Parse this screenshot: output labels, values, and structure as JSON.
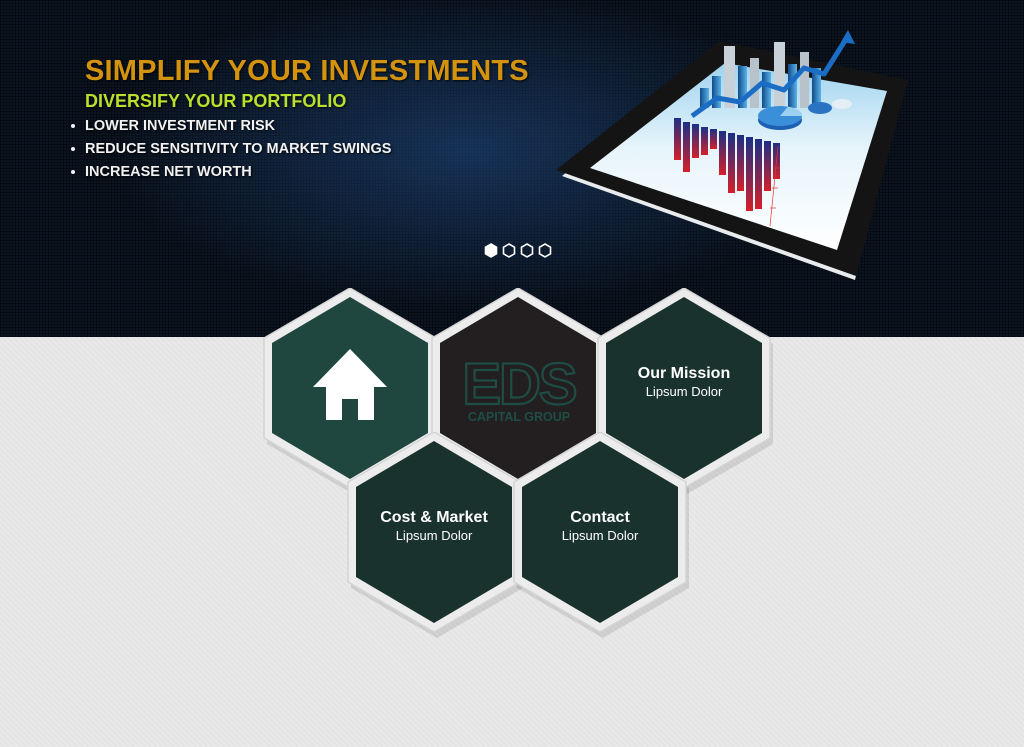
{
  "hero": {
    "headline": "SIMPLIFY YOUR INVESTMENTS",
    "subheadline": "DIVERSIFY YOUR PORTFOLIO",
    "bullets": [
      "LOWER INVESTMENT RISK",
      "REDUCE SENSITIVITY TO MARKET SWINGS",
      "INCREASE NET WORTH"
    ],
    "slider": {
      "total_slides": 4,
      "active_slide": 1
    }
  },
  "logo": {
    "mark": "EDS",
    "tagline": "CAPITAL GROUP"
  },
  "tiles": [
    {
      "title": "Our Mission",
      "subtitle": "Lipsum Dolor"
    },
    {
      "title": "Cost & Market",
      "subtitle": "Lipsum Dolor"
    },
    {
      "title": "Contact",
      "subtitle": "Lipsum Dolor"
    }
  ],
  "icons": {
    "home_tile": "home-icon",
    "slide_indicator": "hexagon-dot-icon"
  },
  "colors": {
    "headline": "#d4930f",
    "subheadline": "#b9e02c",
    "tile_dark": "#1a322d",
    "tile_home": "#204640",
    "logo_tile": "#231f20",
    "logo_mark": "#1e4d46"
  }
}
